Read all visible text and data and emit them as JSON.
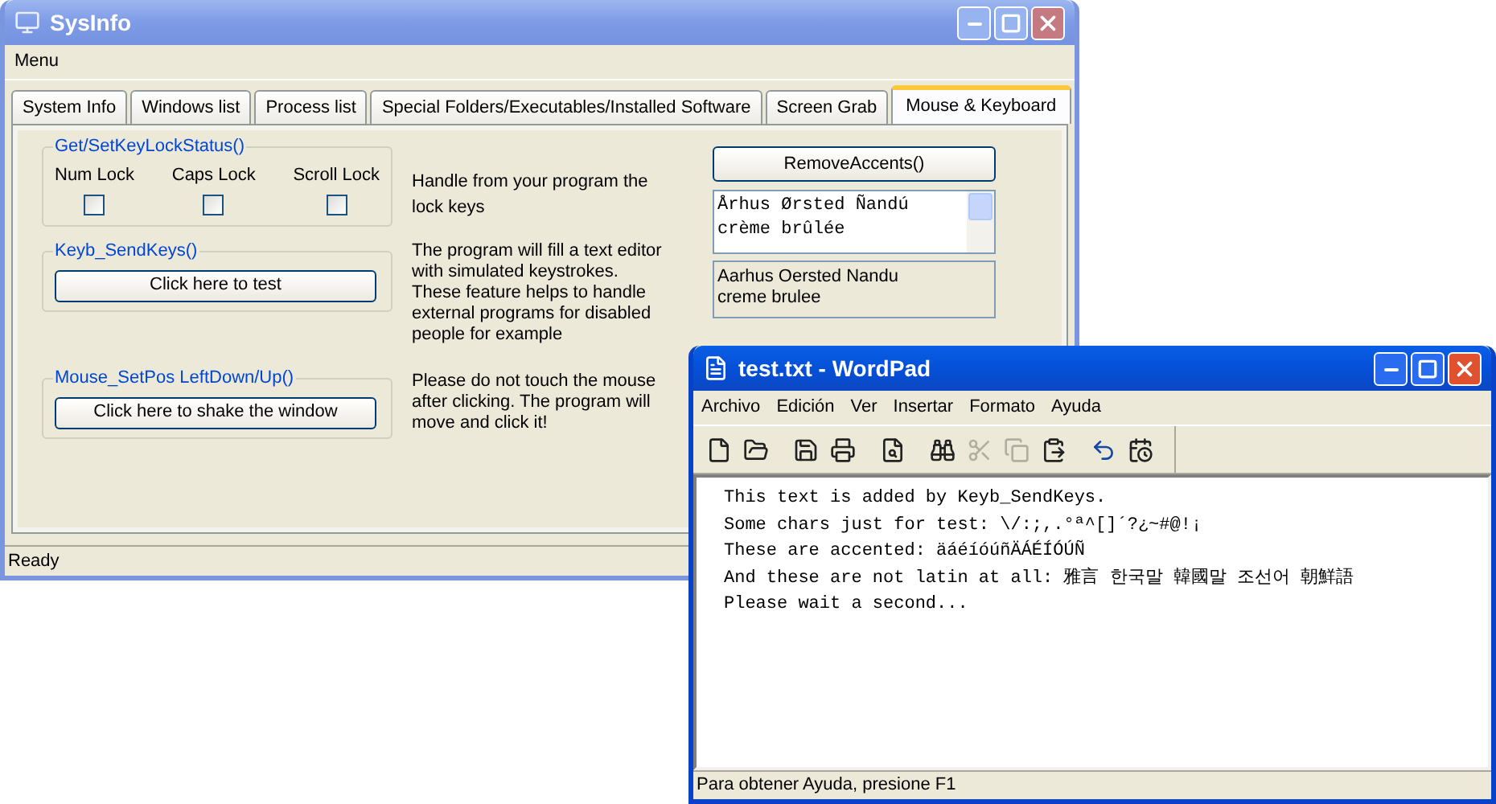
{
  "sysinfo": {
    "title": "SysInfo",
    "active": false,
    "menu": [
      "Menu"
    ],
    "tabs": [
      {
        "label": "System Info",
        "selected": false
      },
      {
        "label": "Windows list",
        "selected": false
      },
      {
        "label": "Process list",
        "selected": false
      },
      {
        "label": "Special Folders/Executables/Installed Software",
        "selected": false
      },
      {
        "label": "Screen Grab",
        "selected": false
      },
      {
        "label": "Mouse & Keyboard",
        "selected": true
      }
    ],
    "lock_group": {
      "title": "Get/SetKeyLockStatus()",
      "locks": [
        {
          "label": "Num Lock",
          "checked": false
        },
        {
          "label": "Caps Lock",
          "checked": false
        },
        {
          "label": "Scroll Lock",
          "checked": false
        }
      ],
      "description": "Handle from your program the lock keys"
    },
    "sendkeys_group": {
      "title": "Keyb_SendKeys()",
      "button": "Click here to test",
      "description": "The program will fill a text editor with simulated keystrokes.\nThese feature helps to handle external programs for disabled people for example"
    },
    "mouse_group": {
      "title": "Mouse_SetPos  LeftDown/Up()",
      "button": "Click here to shake the window",
      "description": "Please do not touch the mouse after clicking. The program will move and click it!"
    },
    "remove_accents": {
      "button": "RemoveAccents()",
      "input": "Århus Ørsted Ñandú\ncrème brûlée",
      "output": "Aarhus Oersted Nandu\ncreme brulee"
    },
    "status_bar": "Ready"
  },
  "wordpad": {
    "title": "test.txt - WordPad",
    "active": true,
    "menu": [
      "Archivo",
      "Edición",
      "Ver",
      "Insertar",
      "Formato",
      "Ayuda"
    ],
    "toolbar": [
      {
        "disabled": false
      },
      {
        "disabled": false
      },
      {
        "disabled": false
      },
      {
        "disabled": false
      },
      {
        "disabled": false
      },
      {
        "disabled": false
      },
      {
        "disabled": true
      },
      {
        "disabled": true
      },
      {
        "disabled": false
      },
      {
        "disabled": false
      },
      {
        "disabled": false
      }
    ],
    "lines": [
      "This text is added by Keyb_SendKeys.",
      "Some chars just for test: \\/:;,.°ª^[]´?¿~#@!¡",
      "These are accented: äáéíóúñÄÁÉÍÓÚÑ",
      "And these are not latin at all: 雅言 한국말 韓國말 조선어 朝鮮語",
      "Please wait a second..."
    ],
    "status_bar": "Para obtener Ayuda, presione F1"
  }
}
